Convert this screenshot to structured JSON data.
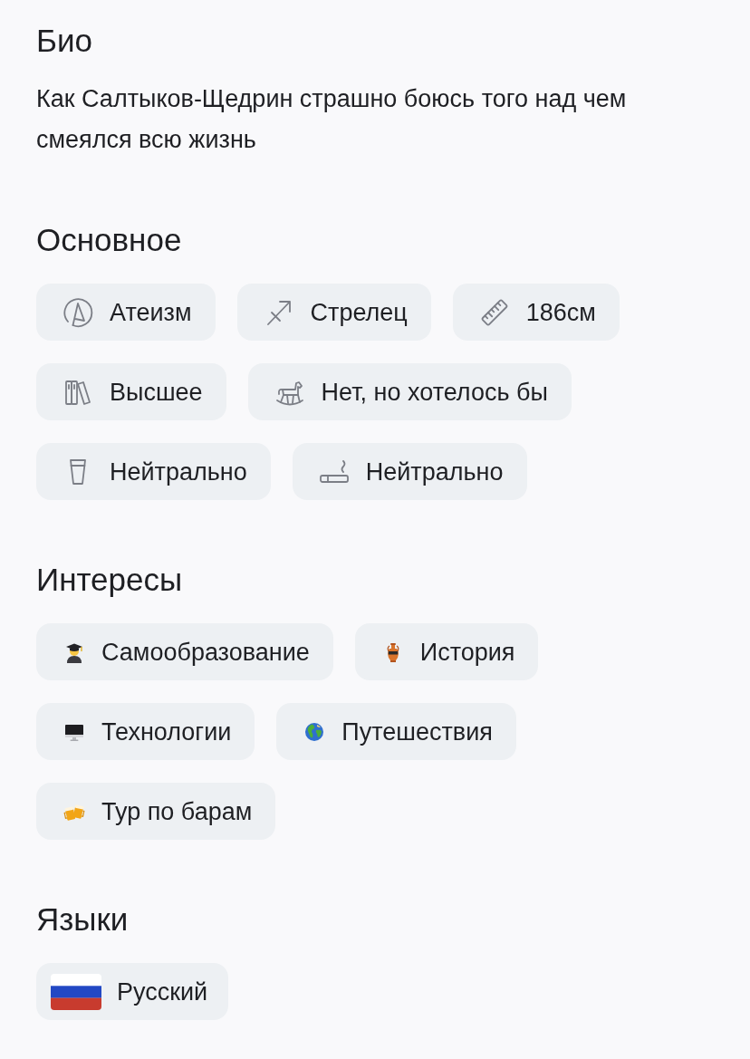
{
  "sections": [
    {
      "kind": "text",
      "title": "Био",
      "text": "Как Салтыков-Щедрин страшно боюсь того над чем смеялся всю жизнь"
    },
    {
      "kind": "facts",
      "title": "Основное",
      "items": [
        {
          "kind": "religion",
          "label": "Атеизм"
        },
        {
          "kind": "zodiac",
          "label": "Стрелец"
        },
        {
          "kind": "height",
          "label": "186см"
        },
        {
          "kind": "education",
          "label": "Высшее"
        },
        {
          "kind": "children",
          "label": "Нет, но хотелось бы"
        },
        {
          "kind": "alcohol",
          "label": "Нейтрально"
        },
        {
          "kind": "smoking",
          "label": "Нейтрально"
        }
      ]
    },
    {
      "kind": "interests",
      "title": "Интересы",
      "items": [
        {
          "kind": "self-education",
          "label": "Самообразование"
        },
        {
          "kind": "history",
          "label": "История"
        },
        {
          "kind": "technology",
          "label": "Технологии"
        },
        {
          "kind": "travel",
          "label": "Путешествия"
        },
        {
          "kind": "bars",
          "label": "Тур по барам"
        }
      ]
    },
    {
      "kind": "languages",
      "title": "Языки",
      "items": [
        {
          "kind": "russian",
          "label": "Русский"
        }
      ]
    }
  ]
}
